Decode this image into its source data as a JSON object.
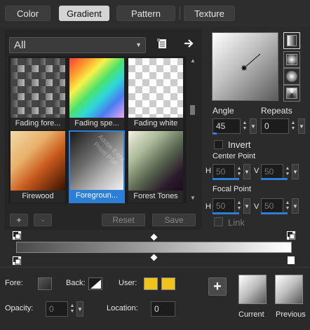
{
  "tabs": [
    {
      "label": "Color",
      "active": false
    },
    {
      "label": "Gradient",
      "active": true
    },
    {
      "label": "Pattern",
      "active": false
    },
    {
      "label": "Texture",
      "active": false
    }
  ],
  "library": {
    "category": "All",
    "items": [
      {
        "name": "Fading fore..."
      },
      {
        "name": "Fading spe..."
      },
      {
        "name": "Fading white"
      },
      {
        "name": "Firewood"
      },
      {
        "name": "Foregroun...",
        "selected": true
      },
      {
        "name": "Forest Tones"
      }
    ],
    "add_label": "+",
    "remove_label": "-",
    "reset_label": "Reset",
    "save_label": "Save"
  },
  "preview": {
    "angle_label": "Angle",
    "angle_value": "45",
    "repeats_label": "Repeats",
    "repeats_value": "0",
    "invert_label": "Invert",
    "center_point_label": "Center Point",
    "center_h_label": "H",
    "center_h_value": "50",
    "center_v_label": "V",
    "center_v_value": "50",
    "focal_point_label": "Focal Point",
    "focal_h_label": "H",
    "focal_h_value": "50",
    "focal_v_label": "V",
    "focal_v_value": "50",
    "link_label": "Link"
  },
  "bottom": {
    "fore_label": "Fore:",
    "back_label": "Back:",
    "user_label": "User:",
    "user_color_1": "#f1c21a",
    "user_color_2": "#f1c21a",
    "opacity_label": "Opacity:",
    "opacity_value": "0",
    "location_label": "Location:",
    "location_value": "0",
    "add_button": "+",
    "current_label": "Current",
    "previous_label": "Previous"
  },
  "watermark": "Adobe Extra Prism PSP",
  "colors": {
    "accent": "#2b7fd6",
    "background": "#2b2b2b",
    "user_swatch": "#f1c21a"
  }
}
